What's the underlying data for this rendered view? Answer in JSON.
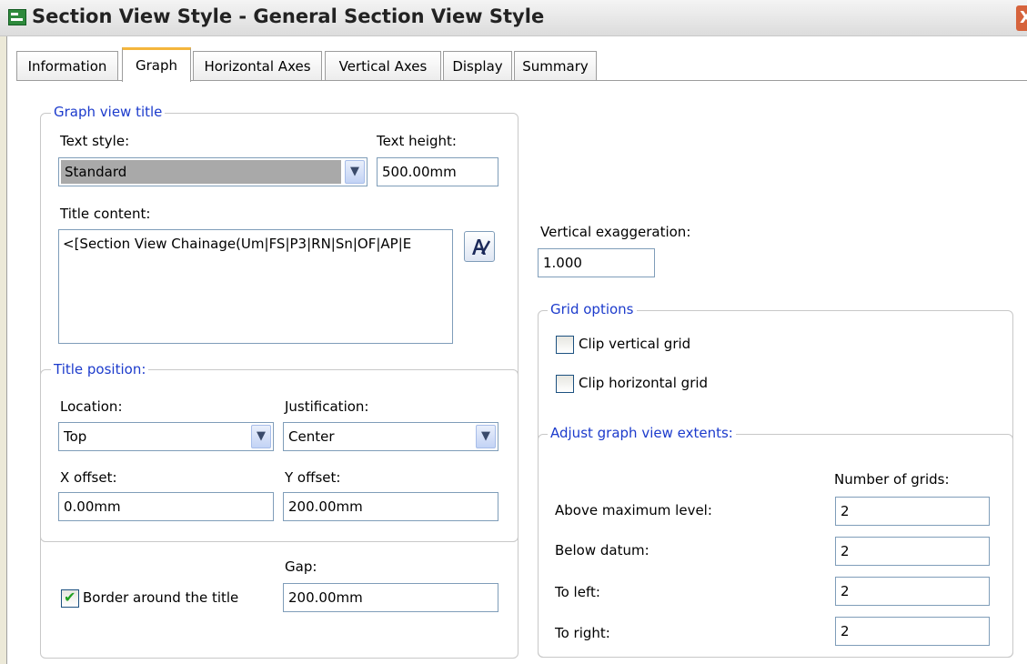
{
  "window": {
    "title": "Section View Style - General Section View Style",
    "close_glyph": "X"
  },
  "tabs": [
    {
      "label": "Information",
      "active": false
    },
    {
      "label": "Graph",
      "active": true
    },
    {
      "label": "Horizontal Axes",
      "active": false
    },
    {
      "label": "Vertical Axes",
      "active": false
    },
    {
      "label": "Display",
      "active": false
    },
    {
      "label": "Summary",
      "active": false
    }
  ],
  "graph_view_title": {
    "legend": "Graph view title",
    "text_style_label": "Text style:",
    "text_style_value": "Standard",
    "text_height_label": "Text height:",
    "text_height_value": "500.00mm",
    "title_content_label": "Title content:",
    "title_content_value": "<[Section View Chainage(Um|FS|P3|RN|Sn|OF|AP|E"
  },
  "title_position": {
    "legend": "Title position:",
    "location_label": "Location:",
    "location_value": "Top",
    "justification_label": "Justification:",
    "justification_value": "Center",
    "x_offset_label": "X offset:",
    "x_offset_value": "0.00mm",
    "y_offset_label": "Y offset:",
    "y_offset_value": "200.00mm"
  },
  "border": {
    "gap_label": "Gap:",
    "gap_value": "200.00mm",
    "border_label": "Border around the title",
    "border_checked": true
  },
  "vertical_exaggeration": {
    "label": "Vertical exaggeration:",
    "value": "1.000"
  },
  "grid_options": {
    "legend": "Grid options",
    "clip_vertical_label": "Clip vertical grid",
    "clip_vertical_checked": false,
    "clip_horizontal_label": "Clip horizontal grid",
    "clip_horizontal_checked": false
  },
  "extents": {
    "legend": "Adjust graph view extents:",
    "number_of_grids_label": "Number of grids:",
    "rows": [
      {
        "label": "Above maximum level:",
        "value": "2"
      },
      {
        "label": "Below datum:",
        "value": "2"
      },
      {
        "label": "To left:",
        "value": "2"
      },
      {
        "label": "To right:",
        "value": "2"
      }
    ]
  },
  "colors": {
    "legend_blue": "#1c3bcc",
    "tab_active_accent": "#f4b63c",
    "checkbox_check": "#21a121"
  }
}
